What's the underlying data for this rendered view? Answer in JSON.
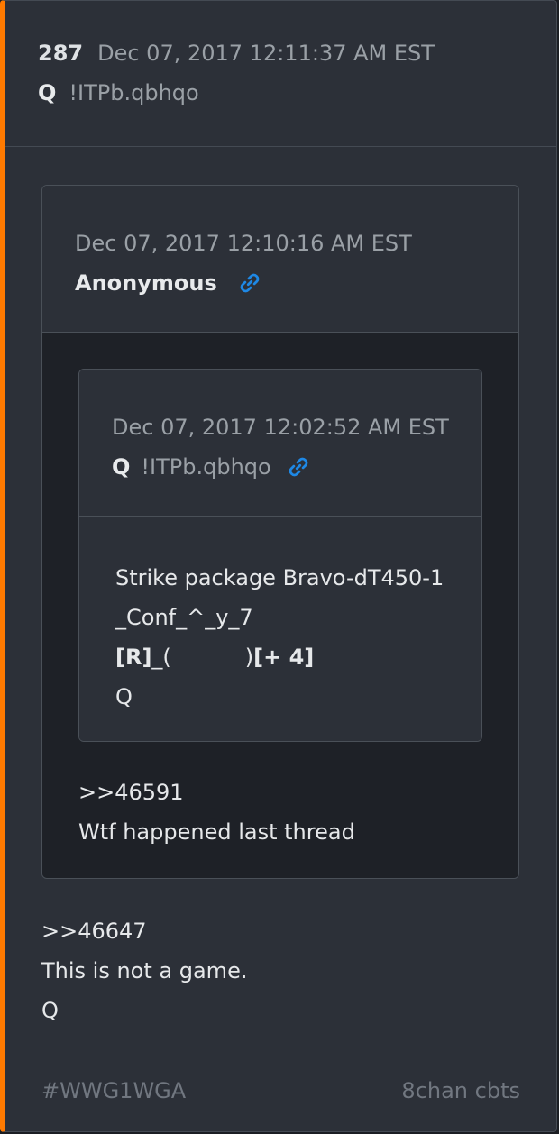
{
  "post": {
    "number": "287",
    "date": "Dec 07, 2017 12:11:37 AM EST",
    "author": "Q",
    "tripcode": "!ITPb.qbhqo"
  },
  "quote_outer": {
    "date": "Dec 07, 2017 12:10:16 AM EST",
    "author": "Anonymous",
    "link_icon": "link-icon",
    "lines": [
      ">>46591",
      "Wtf happened last thread"
    ]
  },
  "quote_inner": {
    "date": "Dec 07, 2017 12:02:52 AM EST",
    "author": "Q",
    "tripcode": "!ITPb.qbhqo",
    "link_icon": "link-icon",
    "lines": {
      "line1": "Strike package Bravo-dT450-1",
      "line2": "_Conf_^_y_7",
      "line3_a": "[R]",
      "line3_b": "_(",
      "line3_c": ")",
      "line3_d": "[+ 4]",
      "line4": "Q"
    }
  },
  "main_text": [
    ">>46647",
    "This is not a game.",
    "Q"
  ],
  "footer": {
    "hashtag": "#WWG1WGA",
    "source": "8chan cbts"
  },
  "colors": {
    "accent": "#ff7a00",
    "link": "#1e88e5",
    "card_bg": "#2c3038",
    "quote_body_bg": "#1e2127"
  }
}
